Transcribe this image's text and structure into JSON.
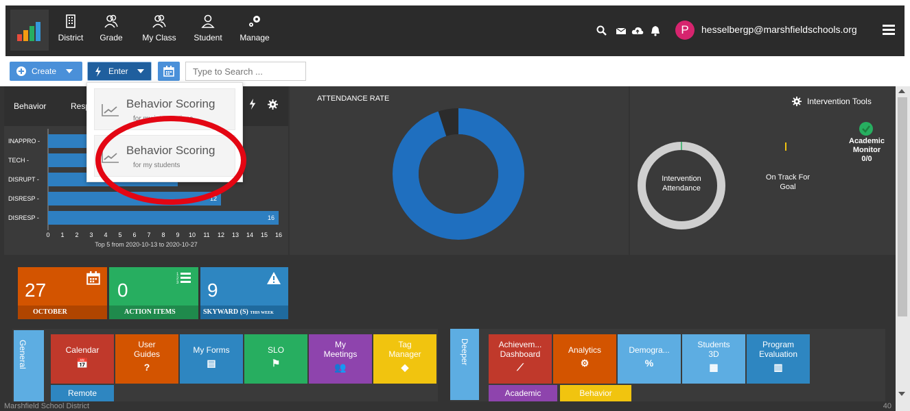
{
  "nav": {
    "items": [
      {
        "label": "District",
        "icon": "building-icon"
      },
      {
        "label": "Grade",
        "icon": "users-icon"
      },
      {
        "label": "My Class",
        "icon": "users-icon"
      },
      {
        "label": "Student",
        "icon": "user-icon"
      },
      {
        "label": "Manage",
        "icon": "gears-icon"
      }
    ],
    "user_initial": "P",
    "user_email": "hesselbergp@marshfieldschools.org"
  },
  "toolbar": {
    "create_label": "Create",
    "enter_label": "Enter",
    "search_placeholder": "Type to Search ..."
  },
  "dropdown": {
    "items": [
      {
        "title": "Behavior Scoring",
        "subtitle": "for my interventions"
      },
      {
        "title": "Behavior Scoring",
        "subtitle": "for my students"
      }
    ]
  },
  "behavior_panel": {
    "tab1": "Behavior",
    "tab2": "Resp",
    "caption": "Top 5 from 2020-10-13 to 2020-10-27"
  },
  "chart_data": {
    "type": "bar",
    "orientation": "horizontal",
    "categories": [
      "INAPPRO",
      "TECH",
      "DISRUPT",
      "DISRESP",
      "DISRESP"
    ],
    "values": [
      8,
      8,
      9,
      12,
      16
    ],
    "value_labels": [
      "",
      "",
      "",
      "12",
      "16"
    ],
    "xticks": [
      "0",
      "1",
      "2",
      "3",
      "4",
      "5",
      "6",
      "7",
      "8",
      "9",
      "10",
      "11",
      "12",
      "13",
      "14",
      "15",
      "16"
    ],
    "xlim": [
      0,
      16
    ],
    "caption": "Top 5 from 2020-10-13 to 2020-10-27"
  },
  "attendance": {
    "title": "ATTENDANCE RATE",
    "rate_fraction": 0.95
  },
  "intervention": {
    "tools_label": "Intervention Tools",
    "ring_label_1": "Intervention",
    "ring_label_2": "Attendance",
    "goal_label_1": "On Track For",
    "goal_label_2": "Goal",
    "monitor_label_1": "Academic",
    "monitor_label_2": "Monitor",
    "monitor_value": "0/0"
  },
  "stat_tiles": [
    {
      "number": "27",
      "label": "OCTOBER",
      "color": "#d35400"
    },
    {
      "number": "0",
      "label": "ACTION ITEMS",
      "color": "#27ae60"
    },
    {
      "number": "9",
      "label": "SKYWARD (S)",
      "suffix": "THIS WEEK",
      "color": "#2e86c1"
    }
  ],
  "general_section": {
    "label": "General",
    "tiles": [
      {
        "label1": "Calendar",
        "label2": "",
        "color": "#c0392b",
        "icon": "calendar-icon"
      },
      {
        "label1": "User",
        "label2": "Guides",
        "color": "#d35400",
        "icon": "question-icon"
      },
      {
        "label1": "My Forms",
        "label2": "",
        "color": "#2e86c1",
        "icon": "file-icon"
      },
      {
        "label1": "SLO",
        "label2": "",
        "color": "#27ae60",
        "icon": "flag-icon"
      },
      {
        "label1": "My",
        "label2": "Meetings",
        "color": "#8e44ad",
        "icon": "group-icon"
      },
      {
        "label1": "Tag",
        "label2": "Manager",
        "color": "#f1c40f",
        "icon": "tag-icon"
      }
    ],
    "remote_label": "Remote"
  },
  "deeper_section": {
    "label": "Deeper",
    "tiles": [
      {
        "label1": "Achievem...",
        "label2": "Dashboard",
        "color": "#c0392b",
        "icon": "chart-line-icon"
      },
      {
        "label1": "Analytics",
        "label2": "",
        "color": "#d35400",
        "icon": "gears-icon"
      },
      {
        "label1": "Demogra...",
        "label2": "",
        "color": "#5dade2",
        "icon": "percent-icon"
      },
      {
        "label1": "Students",
        "label2": "3D",
        "color": "#5dade2",
        "icon": "cubes-icon"
      },
      {
        "label1": "Program",
        "label2": "Evaluation",
        "color": "#2e86c1",
        "icon": "bar-chart-icon"
      }
    ],
    "academic_label": "Academic",
    "behavior_label": "Behavior"
  },
  "footer": {
    "district": "Marshfield School District",
    "right": "40"
  }
}
